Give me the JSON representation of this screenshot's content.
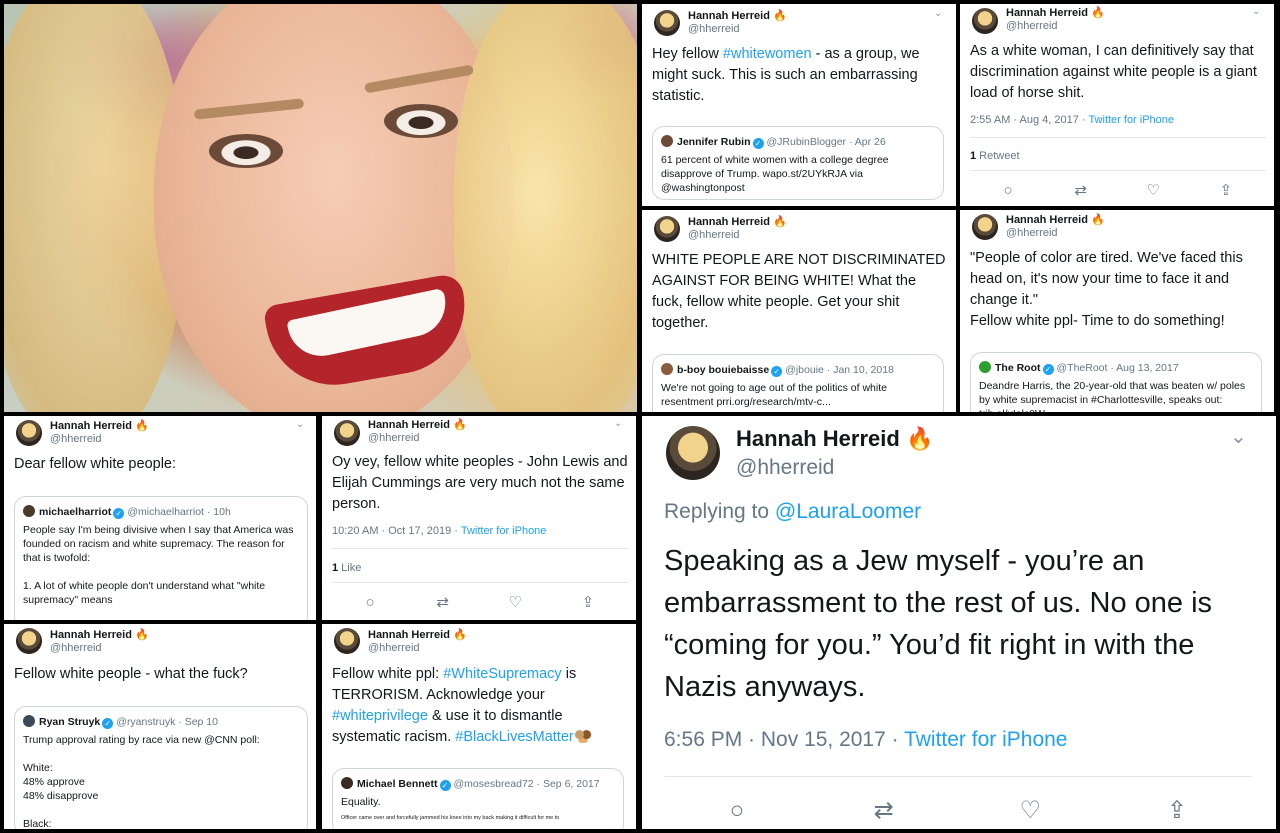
{
  "app": {
    "title": "Hannah Herreid tweet collage"
  },
  "user": {
    "name": "Hannah Herreid",
    "handle": "@hherreid",
    "fire": "🔥"
  },
  "colors": {
    "link": "#1da1f2",
    "muted": "#657786",
    "border": "#ccd6dd"
  },
  "icons": {
    "reply": "reply-icon",
    "retweet": "retweet-icon",
    "like": "heart-icon",
    "share": "share-icon",
    "chevron": "chevron-down-icon",
    "verified": "verified-badge-icon"
  },
  "tweets": {
    "t1": {
      "text_pre": "Hey fellow ",
      "hashtag": "#whitewomen",
      "text_post": " - as a group, we might suck. This is such an embarrassing statistic.",
      "quote": {
        "name": "Jennifer Rubin",
        "meta": "@JRubinBlogger · Apr 26",
        "text": "61 percent of white women with a college degree disapprove of Trump. wapo.st/2UYkRJA via @washingtonpost"
      }
    },
    "t2": {
      "text": "As a white woman, I can definitively say that discrimination against white people is a giant load of horse shit.",
      "time": "2:55 AM · Aug 4, 2017 · ",
      "source": "Twitter for iPhone",
      "retweets_count": "1",
      "retweets_label": " Retweet"
    },
    "t3": {
      "text": "WHITE PEOPLE ARE NOT DISCRIMINATED AGAINST FOR BEING WHITE! What the fuck, fellow white people. Get your shit together.",
      "quote": {
        "name": "b-boy bouiebaisse",
        "meta": "@jbouie · Jan 10, 2018",
        "text": "We're not going to age out of the politics of white resentment prri.org/research/mtv-c..."
      }
    },
    "t4": {
      "text": "\"People of color are tired. We've faced this head on, it's now your time to face it and change it.\"\nFellow white ppl- Time to do something!",
      "quote": {
        "name": "The Root",
        "meta": "@TheRoot · Aug 13, 2017",
        "text": "Deandre Harris, the 20-year-old that was beaten w/ poles by white supremacist in #Charlottesville, speaks out: trib.al/xIolc0W"
      }
    },
    "t5": {
      "text": "Dear fellow white people:",
      "quote": {
        "name": "michaelharriot",
        "meta": "@michaelharriot · 10h",
        "text": "People say I'm being divisive when I say that America was founded on racism and white supremacy. The reason for that is twofold:\n\n1. A lot of white people don't understand what \"white supremacy\" means"
      }
    },
    "t6": {
      "text": "Oy vey, fellow white peoples - John Lewis and Elijah Cummings are very much not the same person.",
      "time": "10:20 AM · Oct 17, 2019 · ",
      "source": "Twitter for iPhone",
      "likes_count": "1",
      "likes_label": " Like"
    },
    "t7": {
      "text": "Fellow white people - what the fuck?",
      "quote": {
        "name": "Ryan Struyk",
        "meta": "@ryanstruyk · Sep 10",
        "text": "Trump approval rating by race via new @CNN poll:\n\nWhite:\n48% approve\n48% disapprove\n\nBlack:"
      }
    },
    "t8": {
      "p1": "Fellow white ppl: ",
      "h1": "#WhiteSupremacy",
      "p2": " is TERRORISM. Acknowledge your ",
      "h2": "#whiteprivilege",
      "p3": " & use it to dismantle systematic racism. ",
      "h3": "#BlackLivesMatter",
      "quote": {
        "name": "Michael Bennett",
        "meta": "@mosesbread72 · Sep 6, 2017",
        "text": "Equality.",
        "small": "Officer came over and forcefully jammed his knee into my back making it difficult for me to"
      }
    },
    "t9": {
      "replying_pre": "Replying to ",
      "replying_to": "@LauraLoomer",
      "text": "Speaking as a Jew myself - you’re an embarrassment to the rest of us. No one is “coming for you.” You’d fit right in with the Nazis anyways.",
      "time": "6:56 PM · Nov 15, 2017 · ",
      "source": "Twitter for iPhone"
    }
  }
}
